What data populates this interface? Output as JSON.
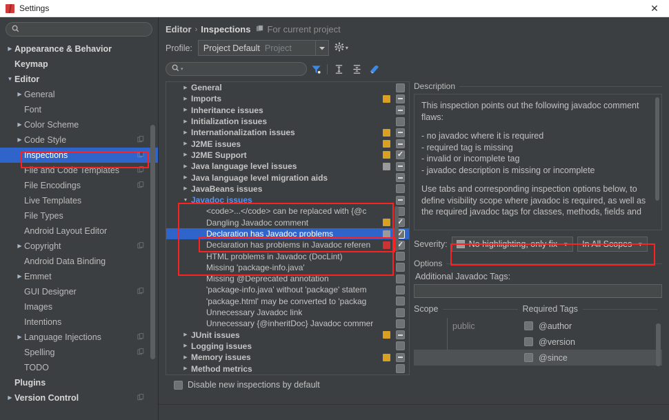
{
  "window": {
    "title": "Settings",
    "app_icon": "intellij-icon",
    "close_label": "✕"
  },
  "sidebar": {
    "search": {
      "placeholder": "",
      "value": "",
      "icon": "search-icon"
    },
    "items": [
      {
        "label": "Appearance & Behavior",
        "arrow": "▶",
        "indent": 0,
        "bold": true,
        "copy": false,
        "selected": false
      },
      {
        "label": "Keymap",
        "arrow": "",
        "indent": 0,
        "bold": true,
        "copy": false,
        "selected": false
      },
      {
        "label": "Editor",
        "arrow": "▼",
        "indent": 0,
        "bold": true,
        "copy": false,
        "selected": false
      },
      {
        "label": "General",
        "arrow": "▶",
        "indent": 1,
        "bold": false,
        "copy": false,
        "selected": false
      },
      {
        "label": "Font",
        "arrow": "",
        "indent": 1,
        "bold": false,
        "copy": false,
        "selected": false
      },
      {
        "label": "Color Scheme",
        "arrow": "▶",
        "indent": 1,
        "bold": false,
        "copy": false,
        "selected": false
      },
      {
        "label": "Code Style",
        "arrow": "▶",
        "indent": 1,
        "bold": false,
        "copy": true,
        "selected": false
      },
      {
        "label": "Inspections",
        "arrow": "",
        "indent": 1,
        "bold": false,
        "copy": true,
        "selected": true
      },
      {
        "label": "File and Code Templates",
        "arrow": "",
        "indent": 1,
        "bold": false,
        "copy": true,
        "selected": false
      },
      {
        "label": "File Encodings",
        "arrow": "",
        "indent": 1,
        "bold": false,
        "copy": true,
        "selected": false
      },
      {
        "label": "Live Templates",
        "arrow": "",
        "indent": 1,
        "bold": false,
        "copy": false,
        "selected": false
      },
      {
        "label": "File Types",
        "arrow": "",
        "indent": 1,
        "bold": false,
        "copy": false,
        "selected": false
      },
      {
        "label": "Android Layout Editor",
        "arrow": "",
        "indent": 1,
        "bold": false,
        "copy": false,
        "selected": false
      },
      {
        "label": "Copyright",
        "arrow": "▶",
        "indent": 1,
        "bold": false,
        "copy": true,
        "selected": false
      },
      {
        "label": "Android Data Binding",
        "arrow": "",
        "indent": 1,
        "bold": false,
        "copy": false,
        "selected": false
      },
      {
        "label": "Emmet",
        "arrow": "▶",
        "indent": 1,
        "bold": false,
        "copy": false,
        "selected": false
      },
      {
        "label": "GUI Designer",
        "arrow": "",
        "indent": 1,
        "bold": false,
        "copy": true,
        "selected": false
      },
      {
        "label": "Images",
        "arrow": "",
        "indent": 1,
        "bold": false,
        "copy": false,
        "selected": false
      },
      {
        "label": "Intentions",
        "arrow": "",
        "indent": 1,
        "bold": false,
        "copy": false,
        "selected": false
      },
      {
        "label": "Language Injections",
        "arrow": "▶",
        "indent": 1,
        "bold": false,
        "copy": true,
        "selected": false
      },
      {
        "label": "Spelling",
        "arrow": "",
        "indent": 1,
        "bold": false,
        "copy": true,
        "selected": false
      },
      {
        "label": "TODO",
        "arrow": "",
        "indent": 1,
        "bold": false,
        "copy": false,
        "selected": false
      },
      {
        "label": "Plugins",
        "arrow": "",
        "indent": 0,
        "bold": true,
        "copy": false,
        "selected": false
      },
      {
        "label": "Version Control",
        "arrow": "▶",
        "indent": 0,
        "bold": true,
        "copy": true,
        "selected": false
      }
    ]
  },
  "breadcrumb": {
    "parent": "Editor",
    "separator": "›",
    "current": "Inspections",
    "scope_icon": "project-scope-icon",
    "scope_text": "For current project"
  },
  "profile": {
    "label": "Profile:",
    "value": "Project Default",
    "suffix": "Project",
    "dropdown_arrow": "▼",
    "gear_icon": "gear-icon",
    "gear_arrow": "▾"
  },
  "inspection_toolbar": {
    "search_placeholder": "",
    "search_value": "",
    "search_icon": "search-icon",
    "search_caret": "▾",
    "filter_icon": "filter-funnel-icon",
    "expand_all_icon": "expand-all-icon",
    "collapse_all_icon": "collapse-all-icon",
    "reset_icon": "reset-brush-icon"
  },
  "inspection_tree": {
    "rows": [
      {
        "label": "General",
        "type": "group",
        "arrow": "▶",
        "severity": "",
        "check": "none"
      },
      {
        "label": "Imports",
        "type": "group",
        "arrow": "▶",
        "severity": "#d9a022",
        "check": "partial"
      },
      {
        "label": "Inheritance issues",
        "type": "group",
        "arrow": "▶",
        "severity": "",
        "check": "partial"
      },
      {
        "label": "Initialization issues",
        "type": "group",
        "arrow": "▶",
        "severity": "",
        "check": "none"
      },
      {
        "label": "Internationalization issues",
        "type": "group",
        "arrow": "▶",
        "severity": "#d9a022",
        "check": "partial"
      },
      {
        "label": "J2ME issues",
        "type": "group",
        "arrow": "▶",
        "severity": "#d9a022",
        "check": "partial"
      },
      {
        "label": "J2ME Support",
        "type": "group",
        "arrow": "▶",
        "severity": "#d9a022",
        "check": "checked"
      },
      {
        "label": "Java language level issues",
        "type": "group",
        "arrow": "▶",
        "severity": "#9a9a9a",
        "check": "partial"
      },
      {
        "label": "Java language level migration aids",
        "type": "group",
        "arrow": "▶",
        "severity": "",
        "check": "partial"
      },
      {
        "label": "JavaBeans issues",
        "type": "group",
        "arrow": "▶",
        "severity": "",
        "check": "none"
      },
      {
        "label": "Javadoc issues",
        "type": "group-open",
        "arrow": "▼",
        "severity": "",
        "check": "partial"
      },
      {
        "label": "<code>...</code> can be replaced with {@c",
        "type": "leaf",
        "arrow": "",
        "severity": "",
        "check": "none"
      },
      {
        "label": "Dangling Javadoc comment",
        "type": "leaf",
        "arrow": "",
        "severity": "#d9a022",
        "check": "checked"
      },
      {
        "label": "Declaration has Javadoc problems",
        "type": "leaf",
        "arrow": "",
        "severity": "#9a9a9a",
        "check": "checked",
        "selected": true
      },
      {
        "label": "Declaration has problems in Javadoc referen",
        "type": "leaf",
        "arrow": "",
        "severity": "#cc3333",
        "check": "checked"
      },
      {
        "label": "HTML problems in Javadoc (DocLint)",
        "type": "leaf",
        "arrow": "",
        "severity": "",
        "check": "none"
      },
      {
        "label": "Missing 'package-info.java'",
        "type": "leaf",
        "arrow": "",
        "severity": "",
        "check": "none"
      },
      {
        "label": "Missing @Deprecated annotation",
        "type": "leaf",
        "arrow": "",
        "severity": "",
        "check": "none"
      },
      {
        "label": "'package-info.java' without 'package' statem",
        "type": "leaf",
        "arrow": "",
        "severity": "",
        "check": "none"
      },
      {
        "label": "'package.html' may be converted to 'packag",
        "type": "leaf",
        "arrow": "",
        "severity": "",
        "check": "none"
      },
      {
        "label": "Unnecessary Javadoc link",
        "type": "leaf",
        "arrow": "",
        "severity": "",
        "check": "none"
      },
      {
        "label": "Unnecessary {@inheritDoc} Javadoc commer",
        "type": "leaf",
        "arrow": "",
        "severity": "",
        "check": "none"
      },
      {
        "label": "JUnit issues",
        "type": "group",
        "arrow": "▶",
        "severity": "#d9a022",
        "check": "partial"
      },
      {
        "label": "Logging issues",
        "type": "group",
        "arrow": "▶",
        "severity": "",
        "check": "none"
      },
      {
        "label": "Memory issues",
        "type": "group",
        "arrow": "▶",
        "severity": "#d9a022",
        "check": "partial"
      },
      {
        "label": "Method metrics",
        "type": "group",
        "arrow": "▶",
        "severity": "",
        "check": "none"
      }
    ],
    "disable_new": {
      "label": "Disable new inspections by default",
      "checked": false
    }
  },
  "description": {
    "title": "Description",
    "paragraphs": [
      "This inspection points out the following javadoc comment flaws:",
      "- no javadoc where it is required",
      "- required tag is missing",
      "- invalid or incomplete tag",
      "- javadoc description is missing or incomplete",
      "Use tabs and corresponding inspection options below, to define visibility scope where javadoc is required, as well as the required javadoc tags for classes, methods, fields and"
    ]
  },
  "severity": {
    "label": "Severity:",
    "value": "No highlighting, only fix",
    "swatch_color": "#9a9a9a",
    "dropdown_arrow": "▼",
    "scope_value": "In All Scopes",
    "scope_arrow": "▼"
  },
  "options": {
    "title": "Options",
    "additional_tags_label": "Additional Javadoc Tags:",
    "additional_tags_value": "",
    "table": {
      "columns": [
        "Scope",
        "Required Tags"
      ],
      "rows": [
        {
          "scope": "public",
          "tag": "@author",
          "checked": false,
          "highlight": false
        },
        {
          "scope": "",
          "tag": "@version",
          "checked": false,
          "highlight": false
        },
        {
          "scope": "",
          "tag": "@since",
          "checked": false,
          "highlight": true
        }
      ]
    }
  },
  "annotations": {
    "accent_color": "#ff2020",
    "boxes": [
      {
        "name": "sidebar-inspections-highlight"
      },
      {
        "name": "javadoc-group-highlight"
      },
      {
        "name": "declaration-has-javadoc-problems-highlight"
      },
      {
        "name": "severity-controls-highlight"
      }
    ]
  }
}
